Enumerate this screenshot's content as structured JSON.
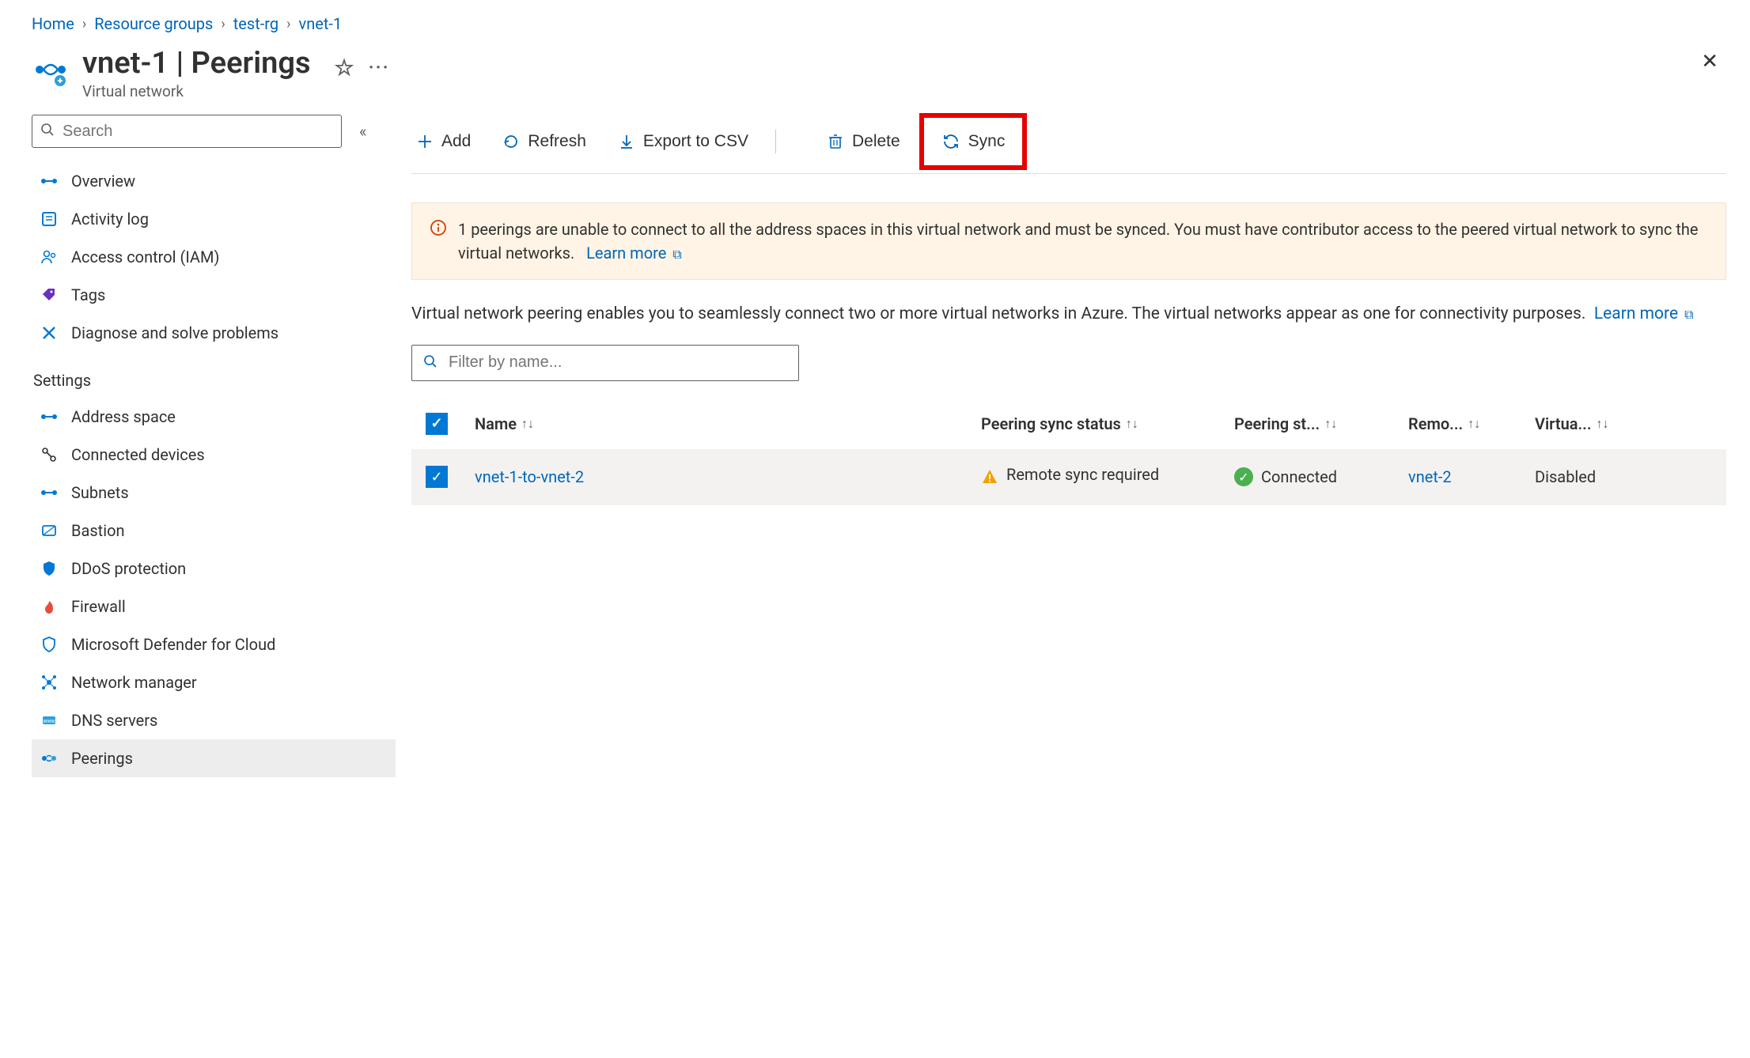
{
  "breadcrumb": {
    "items": [
      {
        "label": "Home"
      },
      {
        "label": "Resource groups"
      },
      {
        "label": "test-rg"
      },
      {
        "label": "vnet-1"
      }
    ]
  },
  "header": {
    "title": "vnet-1 | Peerings",
    "subtitle": "Virtual network"
  },
  "sidebar": {
    "search_placeholder": "Search",
    "top_items": [
      {
        "label": "Overview",
        "icon": "overview"
      },
      {
        "label": "Activity log",
        "icon": "activity"
      },
      {
        "label": "Access control (IAM)",
        "icon": "iam"
      },
      {
        "label": "Tags",
        "icon": "tags"
      },
      {
        "label": "Diagnose and solve problems",
        "icon": "diagnose"
      }
    ],
    "group_label": "Settings",
    "settings_items": [
      {
        "label": "Address space",
        "icon": "address"
      },
      {
        "label": "Connected devices",
        "icon": "devices"
      },
      {
        "label": "Subnets",
        "icon": "subnets"
      },
      {
        "label": "Bastion",
        "icon": "bastion"
      },
      {
        "label": "DDoS protection",
        "icon": "ddos"
      },
      {
        "label": "Firewall",
        "icon": "firewall"
      },
      {
        "label": "Microsoft Defender for Cloud",
        "icon": "defender"
      },
      {
        "label": "Network manager",
        "icon": "networkmgr"
      },
      {
        "label": "DNS servers",
        "icon": "dns"
      },
      {
        "label": "Peerings",
        "icon": "peerings",
        "active": true
      }
    ]
  },
  "toolbar": {
    "add": "Add",
    "refresh": "Refresh",
    "export": "Export to CSV",
    "delete": "Delete",
    "sync": "Sync"
  },
  "alert": {
    "text": "1 peerings are unable to connect to all the address spaces in this virtual network and must be synced. You must have contributor access to the peered virtual network to sync the virtual networks.",
    "link": "Learn more"
  },
  "description": {
    "text": "Virtual network peering enables you to seamlessly connect two or more virtual networks in Azure. The virtual networks appear as one for connectivity purposes.",
    "link": "Learn more"
  },
  "filter": {
    "placeholder": "Filter by name..."
  },
  "table": {
    "headers": {
      "name": "Name",
      "sync": "Peering sync status",
      "peering": "Peering st...",
      "remote": "Remo...",
      "gateway": "Virtua..."
    },
    "rows": [
      {
        "name": "vnet-1-to-vnet-2",
        "sync_status": "Remote sync required",
        "peering_status": "Connected",
        "remote": "vnet-2",
        "gateway": "Disabled"
      }
    ]
  }
}
